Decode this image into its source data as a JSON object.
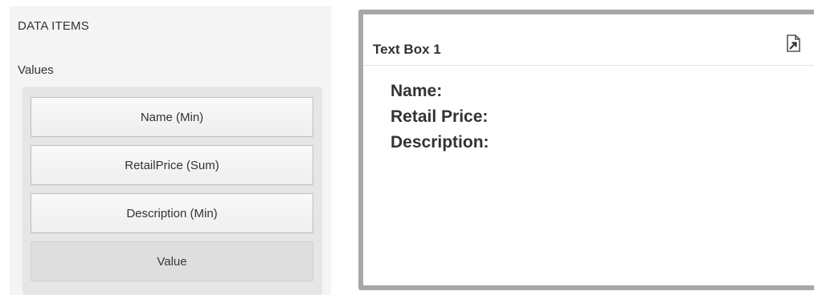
{
  "data_items_panel": {
    "header": "DATA ITEMS",
    "values_label": "Values",
    "items": [
      {
        "label": "Name (Min)"
      },
      {
        "label": "RetailPrice (Sum)"
      },
      {
        "label": "Description (Min)"
      }
    ],
    "placeholder": "Value"
  },
  "text_box": {
    "title": "Text Box 1",
    "export_icon": "export-icon",
    "lines": [
      "Name:",
      "Retail Price:",
      "Description:"
    ]
  },
  "colors": {
    "panel_bg": "#f4f4f4",
    "well_bg": "#e6e6e6",
    "textbox_border": "#a7a7a7",
    "text": "#333333"
  }
}
